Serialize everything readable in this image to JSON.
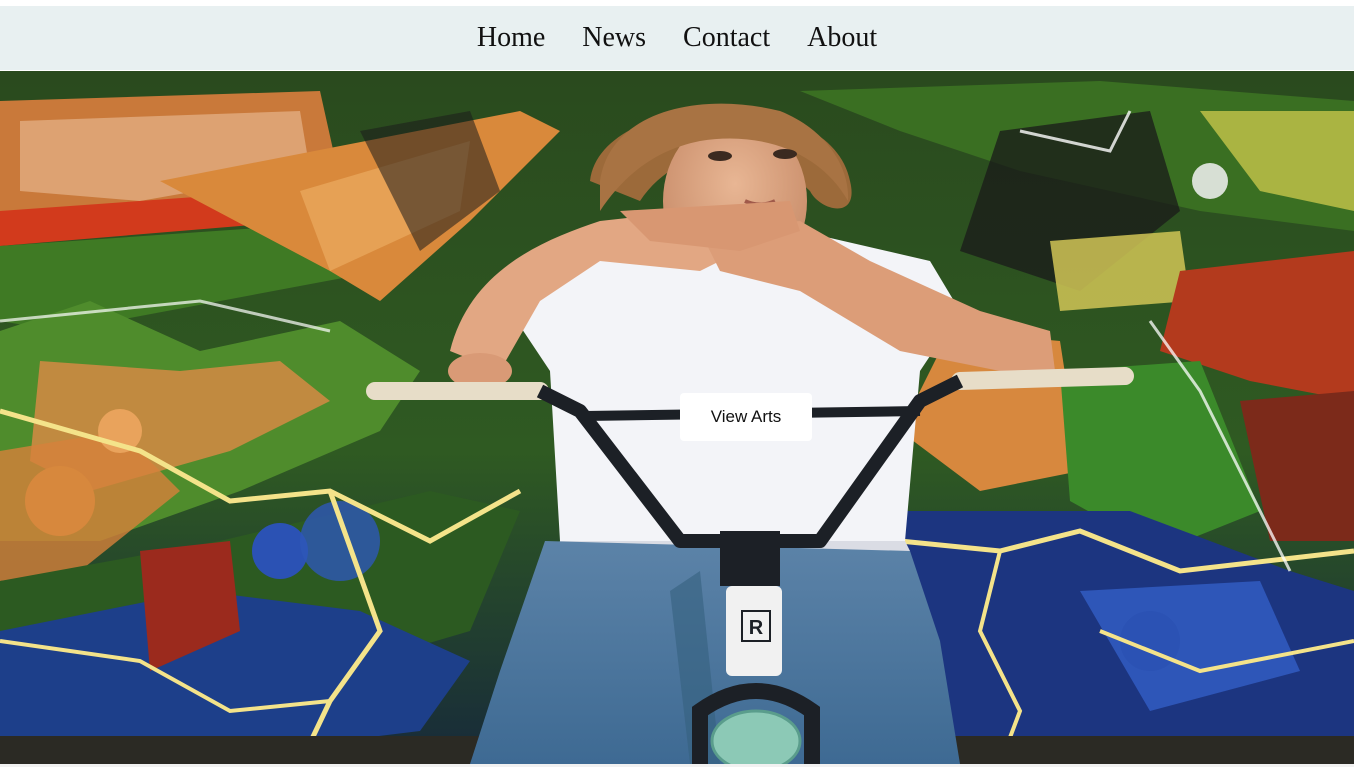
{
  "nav": {
    "items": [
      {
        "label": "Home"
      },
      {
        "label": "News"
      },
      {
        "label": "Contact"
      },
      {
        "label": "About"
      }
    ]
  },
  "hero": {
    "button_label": "View Arts",
    "image_description_icon": "graffiti-bmx-photo",
    "bike_stem_badge": "R"
  },
  "colors": {
    "nav_background": "#e8f0f1",
    "button_background": "#ffffff"
  }
}
